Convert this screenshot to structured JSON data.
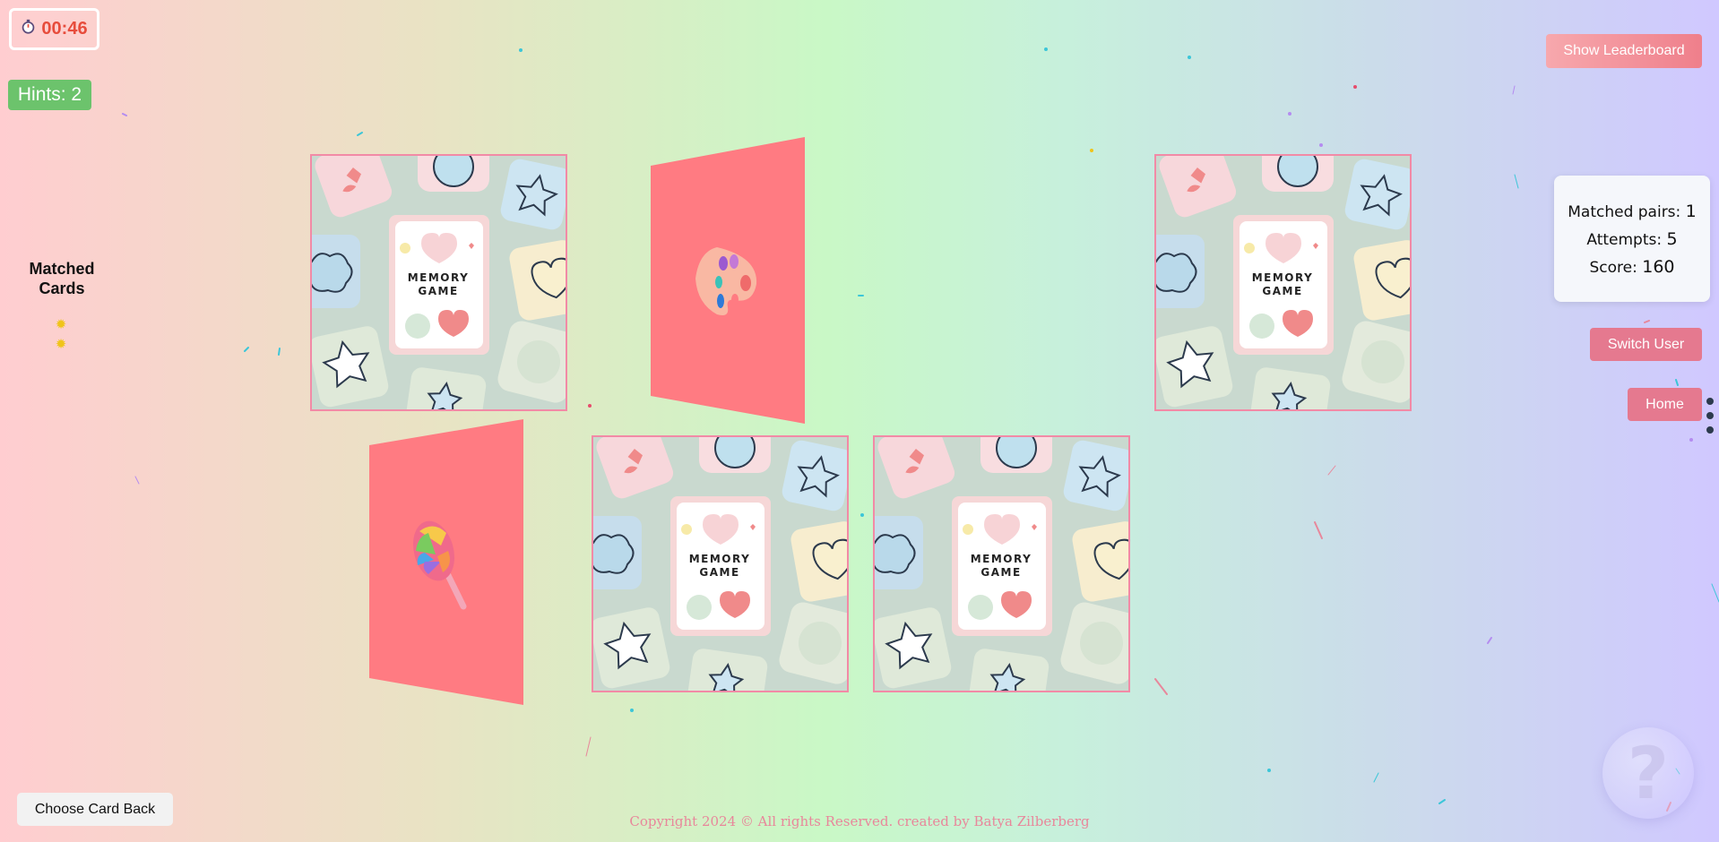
{
  "timer": {
    "value": "00:46",
    "icon": "stopwatch-icon"
  },
  "hints": {
    "label": "Hints: 2"
  },
  "matched_panel": {
    "title_line1": "Matched",
    "title_line2": "Cards",
    "items": [
      "sparkle-icon",
      "sparkle-icon"
    ]
  },
  "card_back": {
    "title_line1": "MEMORY",
    "title_line2": "GAME"
  },
  "revealed_cards": [
    {
      "icon": "palette-icon",
      "color": "#ff7b82"
    },
    {
      "icon": "lollipop-icon",
      "color": "#ff7b82"
    }
  ],
  "buttons": {
    "leaderboard": "Show Leaderboard",
    "switch_user": "Switch User",
    "home": "Home",
    "choose_card_back": "Choose Card Back"
  },
  "stats": {
    "matched_label": "Matched pairs:",
    "matched_value": "1",
    "attempts_label": "Attempts:",
    "attempts_value": "5",
    "score_label": "Score:",
    "score_value": "160"
  },
  "help": {
    "symbol": "?"
  },
  "footer": {
    "copyright": "Copyright 2024 © All rights Reserved. created by Batya Zilberberg"
  },
  "colors": {
    "accent_pink": "#e5798f",
    "timer_red": "#e74c3c",
    "hint_green": "#6cc36c",
    "card_face": "#ff7b82"
  }
}
